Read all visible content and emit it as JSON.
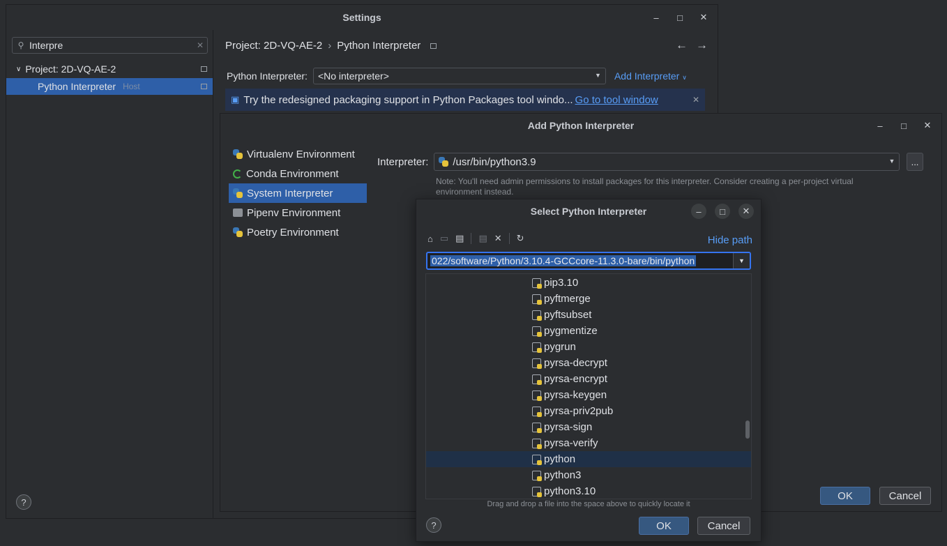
{
  "settings": {
    "title": "Settings",
    "search_value": "Interpre",
    "tree": {
      "project_label": "Project: 2D-VQ-AE-2",
      "interpreter_label": "Python Interpreter",
      "host_label": "Host"
    },
    "breadcrumb": {
      "project": "Project: 2D-VQ-AE-2",
      "page": "Python Interpreter"
    },
    "interpreter_label": "Python Interpreter:",
    "interpreter_value": "<No interpreter>",
    "add_interpreter": "Add Interpreter",
    "banner": {
      "text": "Try the redesigned packaging support in Python Packages tool windo...",
      "link": "Go to tool window"
    },
    "help": "?"
  },
  "add_interpreter": {
    "title": "Add Python Interpreter",
    "environments": [
      {
        "label": "Virtualenv Environment",
        "icon": "python-icon"
      },
      {
        "label": "Conda Environment",
        "icon": "conda-icon"
      },
      {
        "label": "System Interpreter",
        "icon": "python-icon"
      },
      {
        "label": "Pipenv Environment",
        "icon": "pipenv-icon"
      },
      {
        "label": "Poetry Environment",
        "icon": "python-icon"
      }
    ],
    "interpreter_label": "Interpreter:",
    "interpreter_value": "/usr/bin/python3.9",
    "browse_label": "...",
    "note": "Note: You'll need admin permissions to install packages for this interpreter. Consider creating a per-project virtual environment instead.",
    "ok": "OK",
    "cancel": "Cancel"
  },
  "select_interpreter": {
    "title": "Select Python Interpreter",
    "hide_path": "Hide path",
    "path": "022/software/Python/3.10.4-GCCcore-11.3.0-bare/bin/python",
    "files": [
      "pip3.10",
      "pyftmerge",
      "pyftsubset",
      "pygmentize",
      "pygrun",
      "pyrsa-decrypt",
      "pyrsa-encrypt",
      "pyrsa-keygen",
      "pyrsa-priv2pub",
      "pyrsa-sign",
      "pyrsa-verify",
      "python",
      "python3",
      "python3.10"
    ],
    "selected_file": "python",
    "hint": "Drag and drop a file into the space above to quickly locate it",
    "ok": "OK",
    "cancel": "Cancel",
    "help": "?"
  }
}
